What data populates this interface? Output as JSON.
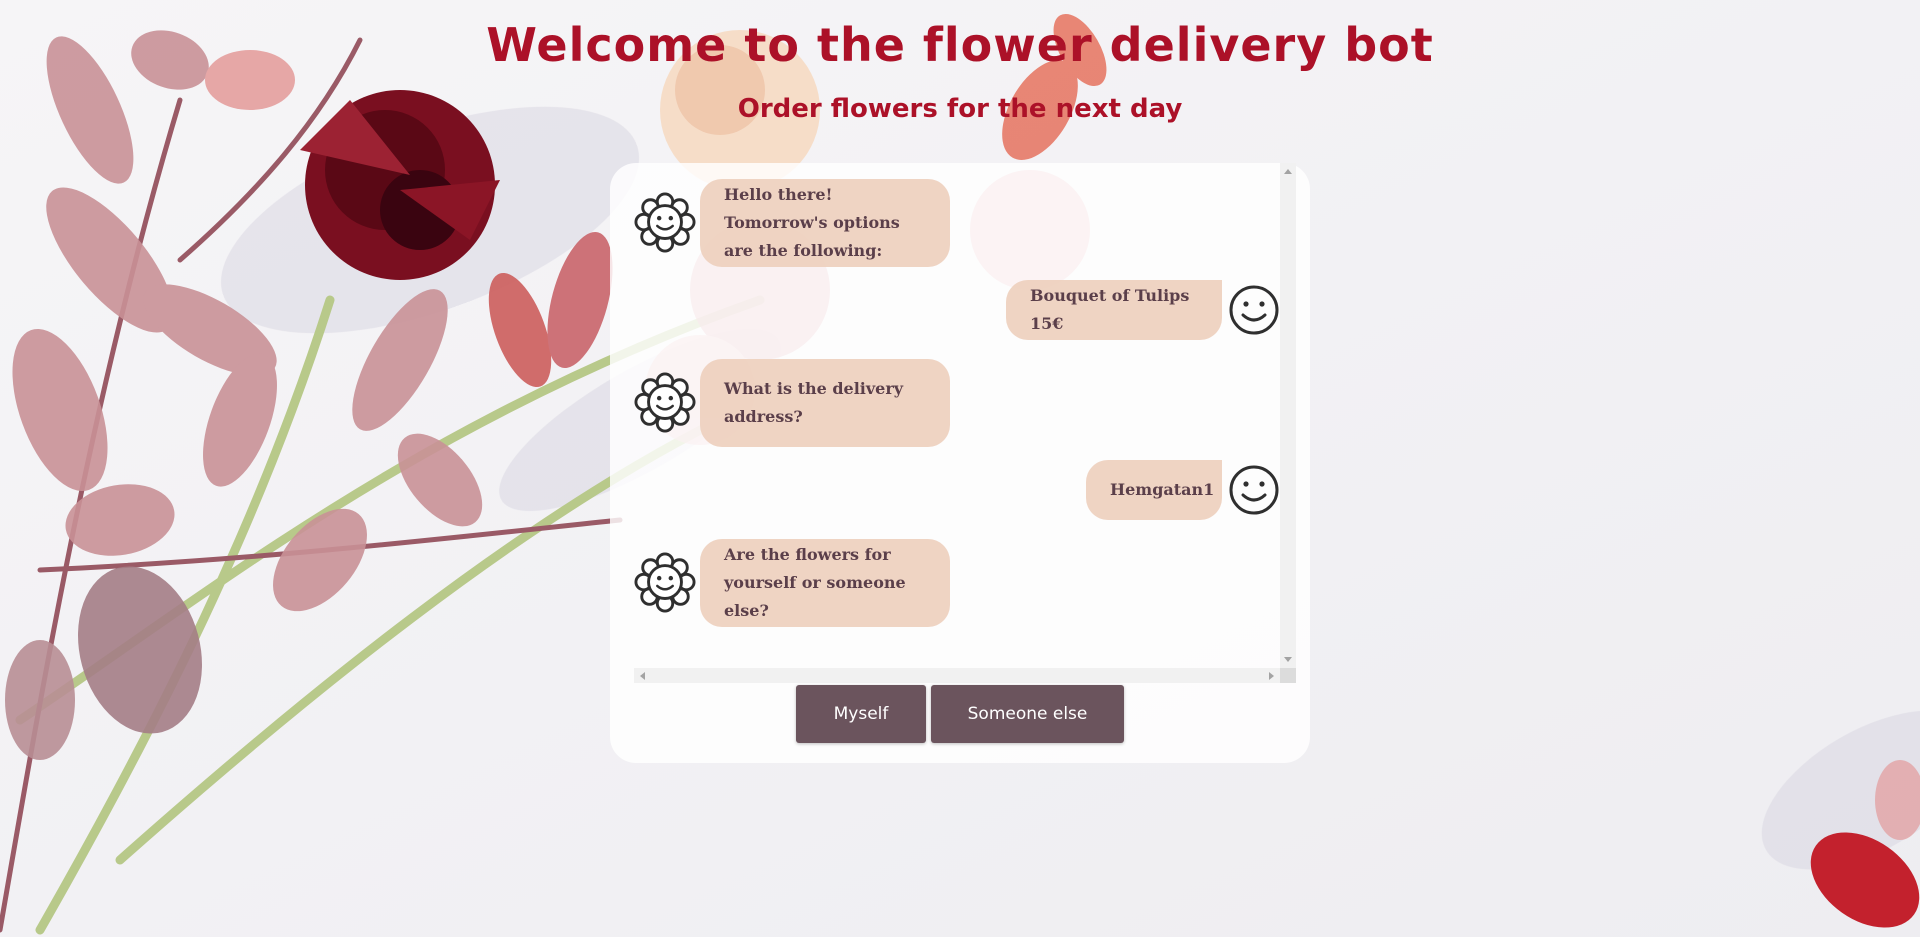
{
  "header": {
    "title": "Welcome to the flower delivery bot",
    "subtitle": "Order flowers for the next day"
  },
  "chat": {
    "messages": [
      {
        "from": "bot",
        "text": "Hello there! Tomorrow's options are the following:",
        "icon": "flower-face-icon"
      },
      {
        "from": "user",
        "text": "Bouquet of Tulips 15€",
        "icon": "smiley-face-icon"
      },
      {
        "from": "bot",
        "text": "What is the delivery address?",
        "icon": "flower-face-icon"
      },
      {
        "from": "user",
        "text": "Hemgatan1",
        "icon": "smiley-face-icon"
      },
      {
        "from": "bot",
        "text": "Are the flowers for yourself or someone else?",
        "icon": "flower-face-icon"
      }
    ]
  },
  "quick_replies": [
    "Myself",
    "Someone else"
  ],
  "colors": {
    "title": "#ac1128",
    "bubble": "#eed0be",
    "bubble_text": "#5b3f4a",
    "button": "#6b545d",
    "button_text": "#ffffff"
  }
}
